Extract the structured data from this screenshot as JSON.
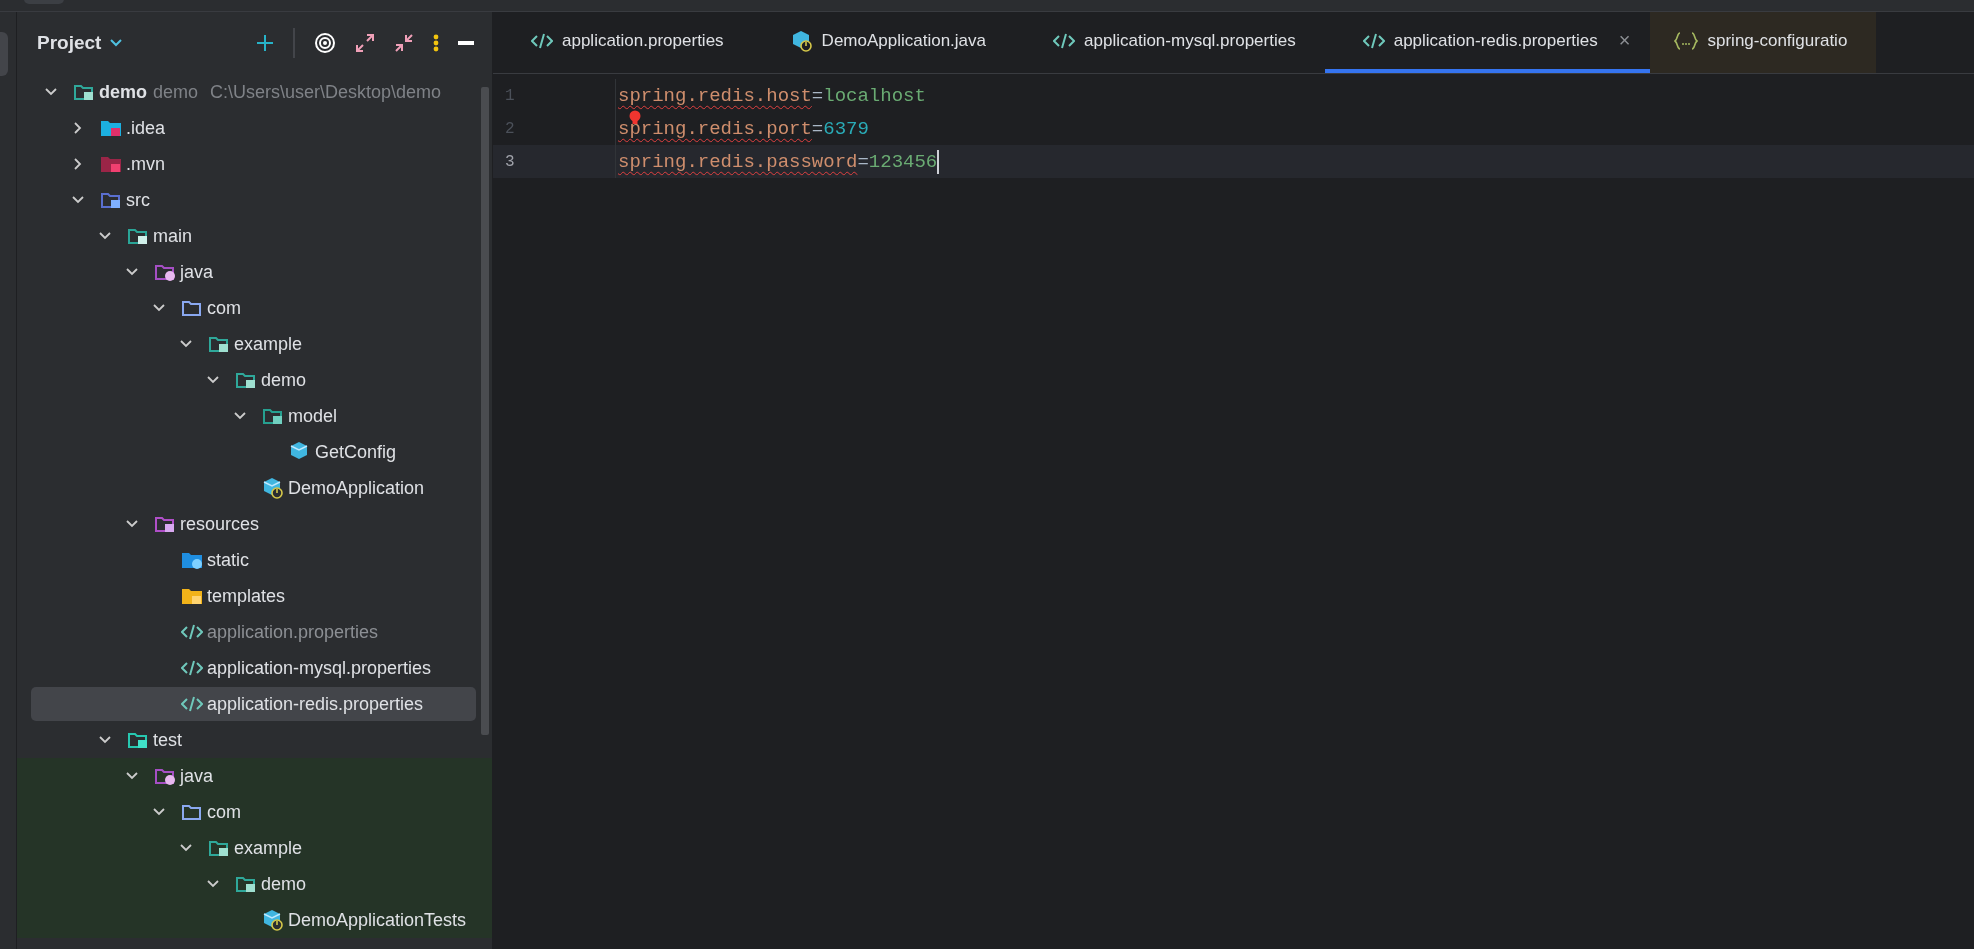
{
  "project_panel": {
    "title": "Project",
    "tree": [
      {
        "name": "demo",
        "module": "demo",
        "path": "C:\\Users\\user\\Desktop\\demo",
        "kind": "module",
        "expanded": true,
        "selected": false,
        "shaded": false,
        "dimmed": false,
        "children": [
          {
            "name": ".idea",
            "kind": "idea",
            "expanded": false,
            "selected": false,
            "shaded": false,
            "dimmed": false
          },
          {
            "name": ".mvn",
            "kind": "mvn",
            "expanded": false,
            "selected": false,
            "shaded": false,
            "dimmed": false
          },
          {
            "name": "src",
            "kind": "src",
            "expanded": true,
            "selected": false,
            "shaded": false,
            "dimmed": false,
            "children": [
              {
                "name": "main",
                "kind": "root",
                "expanded": true,
                "selected": false,
                "shaded": false,
                "dimmed": false,
                "children": [
                  {
                    "name": "java",
                    "kind": "java",
                    "expanded": true,
                    "selected": false,
                    "shaded": false,
                    "dimmed": false,
                    "children": [
                      {
                        "name": "com",
                        "kind": "package",
                        "expanded": true,
                        "selected": false,
                        "shaded": false,
                        "dimmed": false,
                        "children": [
                          {
                            "name": "example",
                            "kind": "module",
                            "expanded": true,
                            "selected": false,
                            "shaded": false,
                            "dimmed": false,
                            "children": [
                              {
                                "name": "demo",
                                "kind": "module",
                                "expanded": true,
                                "selected": false,
                                "shaded": false,
                                "dimmed": false,
                                "children": [
                                  {
                                    "name": "model",
                                    "kind": "model",
                                    "expanded": true,
                                    "selected": false,
                                    "shaded": false,
                                    "dimmed": false,
                                    "children": [
                                      {
                                        "name": "GetConfig",
                                        "kind": "class",
                                        "selected": false,
                                        "shaded": false,
                                        "dimmed": false
                                      }
                                    ]
                                  },
                                  {
                                    "name": "DemoApplication",
                                    "kind": "app",
                                    "selected": false,
                                    "shaded": false,
                                    "dimmed": false
                                  }
                                ]
                              }
                            ]
                          }
                        ]
                      }
                    ]
                  },
                  {
                    "name": "resources",
                    "kind": "resources",
                    "expanded": true,
                    "selected": false,
                    "shaded": false,
                    "dimmed": false,
                    "children": [
                      {
                        "name": "static",
                        "kind": "static",
                        "selected": false,
                        "shaded": false,
                        "dimmed": false
                      },
                      {
                        "name": "templates",
                        "kind": "templates",
                        "selected": false,
                        "shaded": false,
                        "dimmed": false
                      },
                      {
                        "name": "application.properties",
                        "kind": "props",
                        "selected": false,
                        "shaded": false,
                        "dimmed": true
                      },
                      {
                        "name": "application-mysql.properties",
                        "kind": "props",
                        "selected": false,
                        "shaded": false,
                        "dimmed": false
                      },
                      {
                        "name": "application-redis.properties",
                        "kind": "props",
                        "selected": true,
                        "shaded": false,
                        "dimmed": false
                      }
                    ]
                  }
                ]
              },
              {
                "name": "test",
                "kind": "test",
                "expanded": true,
                "selected": false,
                "shaded": false,
                "dimmed": false,
                "children": [
                  {
                    "name": "java",
                    "kind": "java",
                    "expanded": true,
                    "selected": false,
                    "shaded": true,
                    "dimmed": false,
                    "children": [
                      {
                        "name": "com",
                        "kind": "package",
                        "expanded": true,
                        "selected": false,
                        "shaded": true,
                        "dimmed": false,
                        "children": [
                          {
                            "name": "example",
                            "kind": "module",
                            "expanded": true,
                            "selected": false,
                            "shaded": true,
                            "dimmed": false,
                            "children": [
                              {
                                "name": "demo",
                                "kind": "module",
                                "expanded": true,
                                "selected": false,
                                "shaded": true,
                                "dimmed": false,
                                "children": [
                                  {
                                    "name": "DemoApplicationTests",
                                    "kind": "app",
                                    "selected": false,
                                    "shaded": true,
                                    "dimmed": false
                                  }
                                ]
                              }
                            ]
                          }
                        ]
                      }
                    ]
                  }
                ]
              }
            ]
          }
        ]
      }
    ]
  },
  "tabs": [
    {
      "label": "application.properties",
      "kind": "props",
      "selected": false
    },
    {
      "label": "DemoApplication.java",
      "kind": "app",
      "selected": false
    },
    {
      "label": "application-mysql.properties",
      "kind": "props",
      "selected": false
    },
    {
      "label": "application-redis.properties",
      "kind": "props",
      "selected": true,
      "close": "×"
    },
    {
      "label": "spring-configuratio",
      "kind": "json",
      "selected": false
    }
  ],
  "editor": {
    "lines": [
      {
        "number": "1",
        "current": false,
        "bulb": false,
        "tokens": [
          {
            "text": "spring.redis.host",
            "kind": "key",
            "error": true
          },
          {
            "text": "=",
            "kind": "sep",
            "error": false
          },
          {
            "text": "localhost",
            "kind": "string",
            "error": false
          }
        ]
      },
      {
        "number": "2",
        "current": false,
        "bulb": true,
        "tokens": [
          {
            "text": "spring.redis.port",
            "kind": "key",
            "error": true
          },
          {
            "text": "=",
            "kind": "sep",
            "error": false
          },
          {
            "text": "6379",
            "kind": "number",
            "error": false
          }
        ]
      },
      {
        "number": "3",
        "current": true,
        "bulb": false,
        "caret": true,
        "tokens": [
          {
            "text": "spring.redis.password",
            "kind": "key",
            "error": true
          },
          {
            "text": "=",
            "kind": "sep",
            "error": false
          },
          {
            "text": "123456",
            "kind": "string",
            "error": false
          }
        ]
      }
    ]
  }
}
